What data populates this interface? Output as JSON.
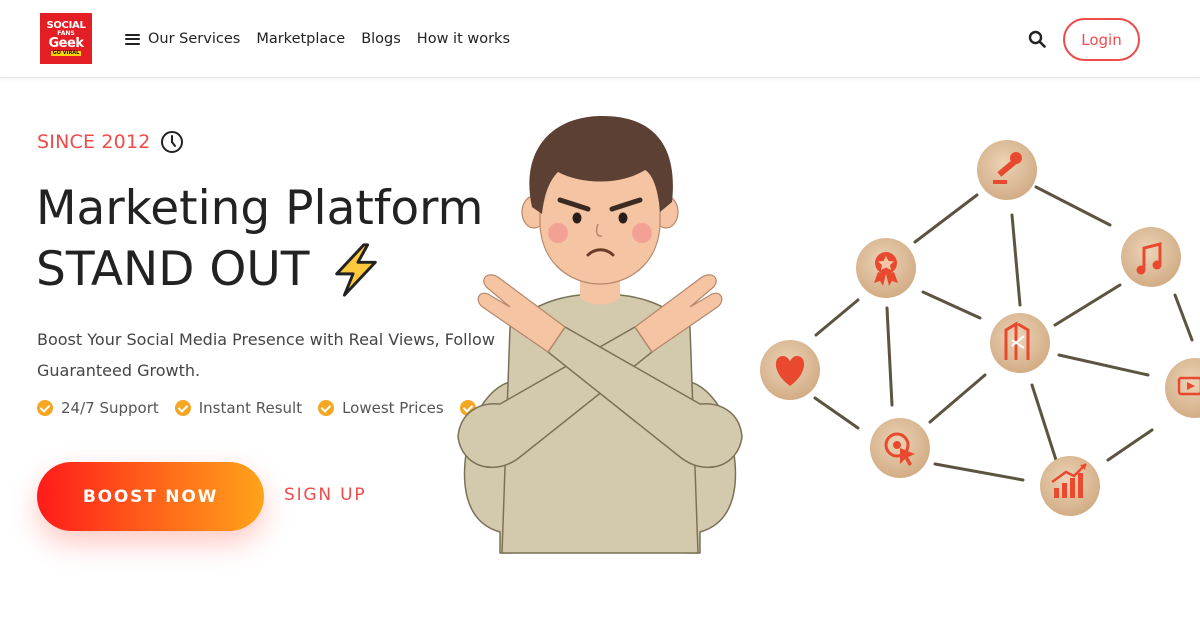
{
  "header": {
    "logo": {
      "line1": "SOCIAL",
      "line2": "FANS",
      "line3": "Geek",
      "tagline": "GO VIRAL"
    },
    "nav": [
      {
        "label": "Our Services",
        "icon": "hamburger-icon"
      },
      {
        "label": "Marketplace"
      },
      {
        "label": "Blogs"
      },
      {
        "label": "How it works"
      }
    ],
    "search_icon": "search-icon",
    "login_label": "Login"
  },
  "hero": {
    "since": "SINCE 2012",
    "headline_line1": "Marketing Platform",
    "headline_line2": "STAND OUT",
    "subtext_line1": "Boost Your Social Media Presence with Real Views, Follow",
    "subtext_line2": "Guaranteed Growth.",
    "features": [
      "24/7 Support",
      "Instant Result",
      "Lowest Prices"
    ],
    "boost_label": "BOOST NOW",
    "signup_label": "SIGN UP"
  },
  "colors": {
    "accent": "#ef4b4b",
    "check": "#f5a623",
    "gradient_start": "#ff1a1a",
    "gradient_end": "#ffa41a"
  },
  "illustrations": {
    "person": "person-crossed-arms-illustration",
    "network_icons": [
      "microphone-icon",
      "music-icon",
      "badge-icon",
      "heart-icon",
      "brand-logo-icon",
      "video-icon",
      "click-target-icon",
      "growth-chart-icon"
    ]
  }
}
